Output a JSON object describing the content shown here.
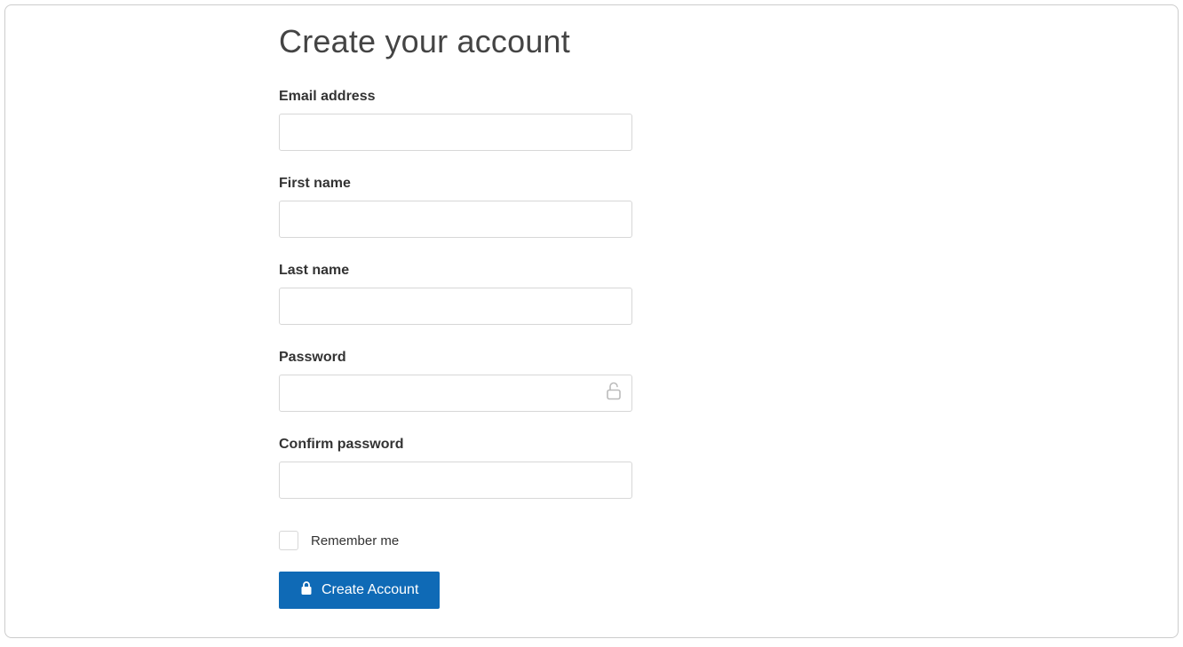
{
  "page": {
    "title": "Create your account"
  },
  "form": {
    "email": {
      "label": "Email address",
      "value": ""
    },
    "first_name": {
      "label": "First name",
      "value": ""
    },
    "last_name": {
      "label": "Last name",
      "value": ""
    },
    "password": {
      "label": "Password",
      "value": ""
    },
    "confirm_password": {
      "label": "Confirm password",
      "value": ""
    },
    "remember_me": {
      "label": "Remember me",
      "checked": false
    },
    "submit_label": "Create Account"
  },
  "colors": {
    "primary_button": "#0f6ab6"
  }
}
